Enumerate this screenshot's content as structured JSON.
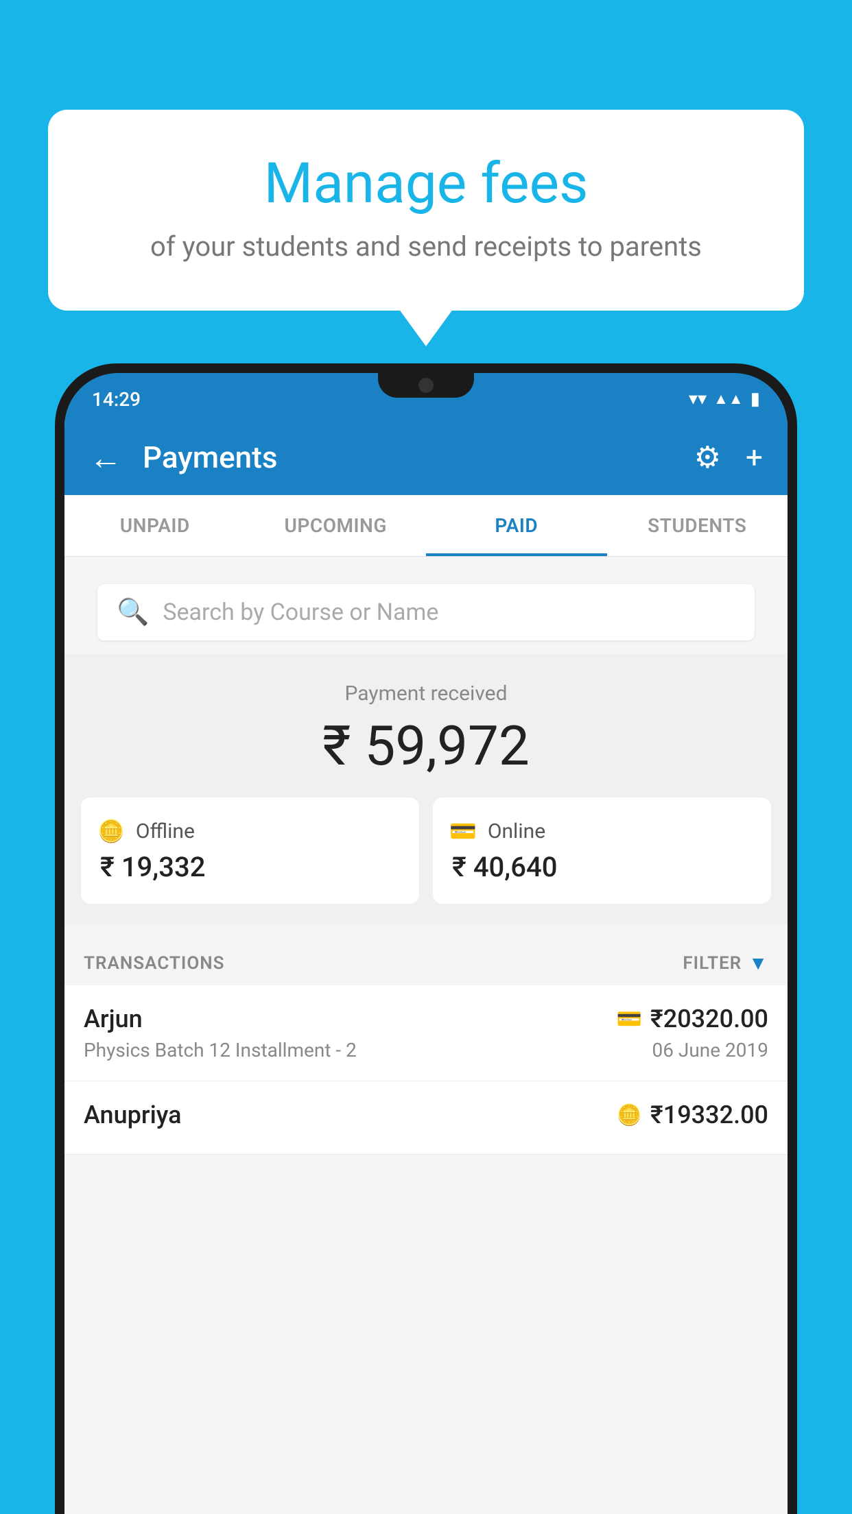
{
  "bubble": {
    "title": "Manage fees",
    "subtitle": "of your students and send receipts to parents"
  },
  "status_bar": {
    "time": "14:29",
    "wifi": "▼",
    "signal": "▲",
    "battery": "▮"
  },
  "header": {
    "title": "Payments",
    "back_label": "←",
    "plus_label": "+"
  },
  "tabs": [
    {
      "label": "UNPAID",
      "active": false
    },
    {
      "label": "UPCOMING",
      "active": false
    },
    {
      "label": "PAID",
      "active": true
    },
    {
      "label": "STUDENTS",
      "active": false
    }
  ],
  "search": {
    "placeholder": "Search by Course or Name"
  },
  "payment_summary": {
    "received_label": "Payment received",
    "total_amount": "₹ 59,972",
    "offline": {
      "label": "Offline",
      "amount": "₹ 19,332"
    },
    "online": {
      "label": "Online",
      "amount": "₹ 40,640"
    }
  },
  "transactions": {
    "label": "TRANSACTIONS",
    "filter_label": "FILTER",
    "items": [
      {
        "name": "Arjun",
        "amount": "₹20320.00",
        "course": "Physics Batch 12 Installment - 2",
        "date": "06 June 2019",
        "mode": "online"
      },
      {
        "name": "Anupriya",
        "amount": "₹19332.00",
        "course": "",
        "date": "",
        "mode": "offline"
      }
    ]
  }
}
